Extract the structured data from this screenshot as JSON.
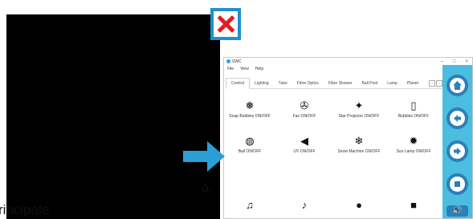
{
  "doc": {
    "line1": "a.",
    "line2": "rincipale"
  },
  "close_button": {
    "icon": "close-x-icon",
    "color": "#e21c24",
    "border_color": "#1f8fd0"
  },
  "app": {
    "title": "SWC",
    "window_controls": [
      "–",
      "□",
      "×"
    ],
    "menu": [
      "File",
      "View",
      "Help"
    ],
    "tabs": [
      "Control",
      "Lighting",
      "Tube",
      "Fibre Optics",
      "Fibre Shower",
      "Ball Pool",
      "Lamp",
      "Planet"
    ],
    "tab_scroll": [
      "‹",
      "›"
    ],
    "tiles": [
      {
        "label": "Soap Bubbles ON/OFF",
        "icon": "soap-bubbles-icon"
      },
      {
        "label": "Fan ON/OFF",
        "icon": "fan-icon"
      },
      {
        "label": "Star Projector ON/OFF",
        "icon": "star-projector-icon"
      },
      {
        "label": "Bubbles ON/OFF",
        "icon": "bubbles-icon"
      },
      {
        "label": "Ball ON/OFF",
        "icon": "mirror-ball-icon"
      },
      {
        "label": "UV ON/OFF",
        "icon": "uv-light-icon"
      },
      {
        "label": "Snow Machine ON/OFF",
        "icon": "snowflake-icon"
      },
      {
        "label": "Sun Lamp ON/OFF",
        "icon": "sun-icon"
      }
    ],
    "bottom_icons": [
      "music-notes-icon",
      "music-wave-icon",
      "lightbulb-icon",
      "square-icon"
    ],
    "side_buttons": [
      "home-icon",
      "arrow-left-icon",
      "arrow-right-icon",
      "stop-icon",
      "speaker-icon"
    ],
    "accent": "#4bbde0"
  },
  "pointer": {
    "icon": "arrow-right-icon",
    "color": "#2a9fd6"
  }
}
